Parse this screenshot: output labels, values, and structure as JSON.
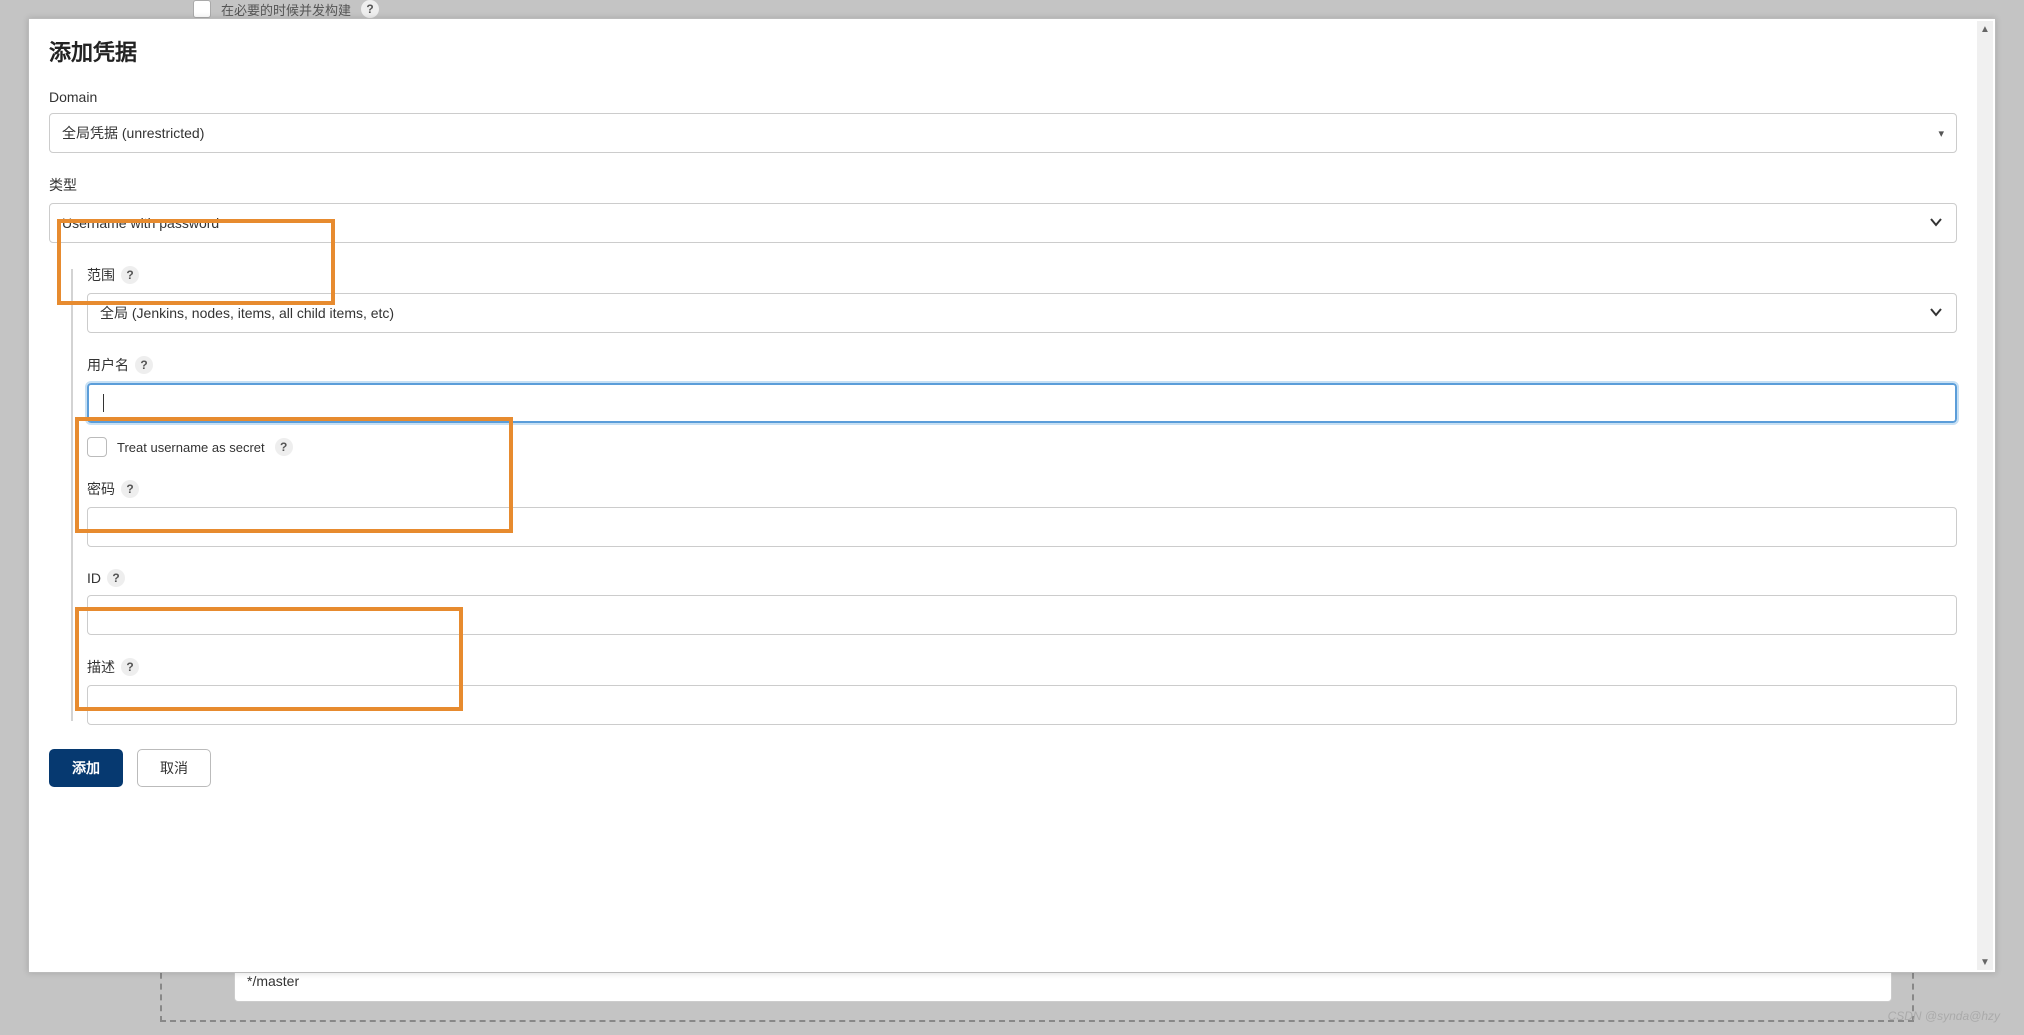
{
  "background": {
    "checkbox_label": "在必要的时候并发构建",
    "branch_input_value": "*/master"
  },
  "modal": {
    "title": "添加凭据",
    "domain": {
      "label": "Domain",
      "selected": "全局凭据 (unrestricted)"
    },
    "type": {
      "label": "类型",
      "selected": "Username with password"
    },
    "scope": {
      "label": "范围",
      "selected": "全局 (Jenkins, nodes, items, all child items, etc)"
    },
    "username": {
      "label": "用户名",
      "value": ""
    },
    "treat_secret": {
      "label": "Treat username as secret",
      "checked": false
    },
    "password": {
      "label": "密码",
      "value": ""
    },
    "id": {
      "label": "ID",
      "value": ""
    },
    "description": {
      "label": "描述",
      "value": ""
    },
    "actions": {
      "add": "添加",
      "cancel": "取消"
    }
  },
  "watermark": "CSDN @synda@hzy"
}
